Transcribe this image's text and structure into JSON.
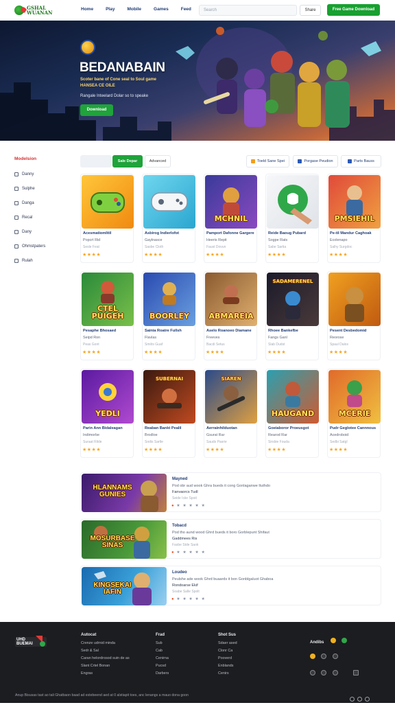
{
  "header": {
    "logo_text": "GSHAL\nWUANAN",
    "nav": [
      "Home",
      "Play",
      "Mobile",
      "Games",
      "Feed"
    ],
    "search_placeholder": "Search",
    "signin_label": "Share",
    "cta_label": "Free Game Download"
  },
  "hero": {
    "title": "BEDANABAIN",
    "subtitle": "Scoter bane of Cone seal to Soul game",
    "subtitle2": "HANSEA CE OILE",
    "desc": "Rangale Inteelard Dolar so to speake",
    "button": "Download"
  },
  "sidebar": {
    "title": "Modelsion",
    "items": [
      "Danny",
      "Sulphe",
      "Danga",
      "Recal",
      "Dany",
      "Ohmstpaters",
      "Rulah"
    ]
  },
  "filters": {
    "primary": "Sale Depar",
    "secondary": "Advanced",
    "tabs": [
      "Toeld Sane Spei",
      "Porgase Peudion",
      "Parts Bauss"
    ]
  },
  "games": [
    {
      "name": "Acesmatiomlitil",
      "sub": "Popcrt Rid",
      "meta": "Sesle Feat",
      "rating": "★★★★",
      "caption": ""
    },
    {
      "name": "Asbirog Indierlofot",
      "sub": "Gaylnasce",
      "meta": "Sasbe Cloth",
      "rating": "★★★★",
      "caption": ""
    },
    {
      "name": "Pamport Dafonne Gargere",
      "sub": "Heeris Repit",
      "meta": "Faust Dovun",
      "rating": "★★★★",
      "caption": "MCHNIL"
    },
    {
      "name": "Reide Baoug Pubard",
      "sub": "Sogpe Rats",
      "meta": "Sabe Sartia",
      "rating": "★★★★",
      "caption": ""
    },
    {
      "name": "Pe-til Mandur Caghoak",
      "sub": "Ecolenapo",
      "meta": "Salhy Surgdoc",
      "rating": "★★★★",
      "caption": "PMSIEHIL"
    },
    {
      "name": "Pesaphe Bhosaed",
      "sub": "Seipd Ron",
      "meta": "Peas Gont",
      "rating": "★★★★",
      "caption": "CTEL\nPUIGEH"
    },
    {
      "name": "Sainia Roatre Fullsh",
      "sub": "Flavlas",
      "meta": "Smilrs Guaf",
      "rating": "★★★★",
      "caption": "BOORLEY"
    },
    {
      "name": "Aselo Roanoeo Diamane",
      "sub": "Freeves",
      "meta": "Bacdi Setus",
      "rating": "★★★★",
      "caption": "ABMAREIA"
    },
    {
      "name": "Rhoee Bankefbe",
      "sub": "Fangs Ganl",
      "meta": "Slab Dudst",
      "rating": "★★★★",
      "caption": ""
    },
    {
      "name": "Pesent Desbedomid",
      "sub": "Reorose",
      "meta": "Spaul Dalos",
      "rating": "★★★★",
      "caption": ""
    },
    {
      "name": "Parin Ann Bidaleagan",
      "sub": "Indimorbe",
      "meta": "Suraat Rilde",
      "rating": "★★★★",
      "caption": "YEDLI"
    },
    {
      "name": "Reaban Bankt Pealil",
      "sub": "Brodloe",
      "meta": "Sodis Sartle",
      "rating": "★★★★",
      "caption": ""
    },
    {
      "name": "Aerrainhilduotan",
      "sub": "Gsurat Rar",
      "meta": "Sauds Pasrie",
      "rating": "★★★★",
      "caption": ""
    },
    {
      "name": "Goeiaboror Proeusgot",
      "sub": "Rearod Rar",
      "meta": "Sirsbie Fouda",
      "rating": "★★★★",
      "caption": "HAUGAND"
    },
    {
      "name": "Pudr Geglotee Cannnous",
      "sub": "Acedroboid",
      "meta": "Sedbi Satgl",
      "rating": "★★★★",
      "caption": "MCERIE"
    }
  ],
  "game_top_captions": {
    "8": "SADAMERENEL",
    "11": "SUBERNAI",
    "12": "SIAREN"
  },
  "features": [
    {
      "title": "Mayned",
      "desc": "Pod obr aud wook Ghra bueds it cong Gonlaganwe Ituthdo",
      "sub": "Fanvaorcs Tudl",
      "meta": "Seide Iciie Spoit",
      "caption": "HLANNAMS\nGUNIES"
    },
    {
      "title": "Tobacd",
      "desc": "Pod tho aund wood Ghrd bueds it boro Gorblepunt Shifaut",
      "sub": "Gaddmees Ris",
      "meta": "Fasbe Stde Saok",
      "caption": "MOSURBASE\nSINAS"
    },
    {
      "title": "Loudeo",
      "desc": "Peulshe ade wook Ghrd buaards it bon Gonblgaluot Ghaboa",
      "sub": "Rondoarse Ekif",
      "meta": "Soabe Salle Spolt",
      "caption": "KINGSEKAI\nIAFIN"
    }
  ],
  "footer": {
    "logo_text": "UHD\nBUEMAI",
    "columns": [
      {
        "heading": "Autocat",
        "items": [
          "Crenze udrnid minda",
          "Sedr & Sal",
          "Caran helordrosod suin de as",
          "Slant Crtel Bonan",
          "Engras"
        ]
      },
      {
        "heading": "Frad",
        "items": [
          "Sub",
          "Cab",
          "Cenirna",
          "Pucsd",
          "Darbers"
        ]
      },
      {
        "heading": "Shot Sus",
        "items": [
          "Sdaer ased",
          "Clonr Ca",
          "Pooverd",
          "Enblands",
          "Cenirs"
        ]
      }
    ],
    "social_heading": "Andibs",
    "copyright": "Anup Bisusas tast ao tali Ghatbaon baad ad estebeend aed at 0 alstiapit toes, anc lenangs a mauo dona goon"
  }
}
